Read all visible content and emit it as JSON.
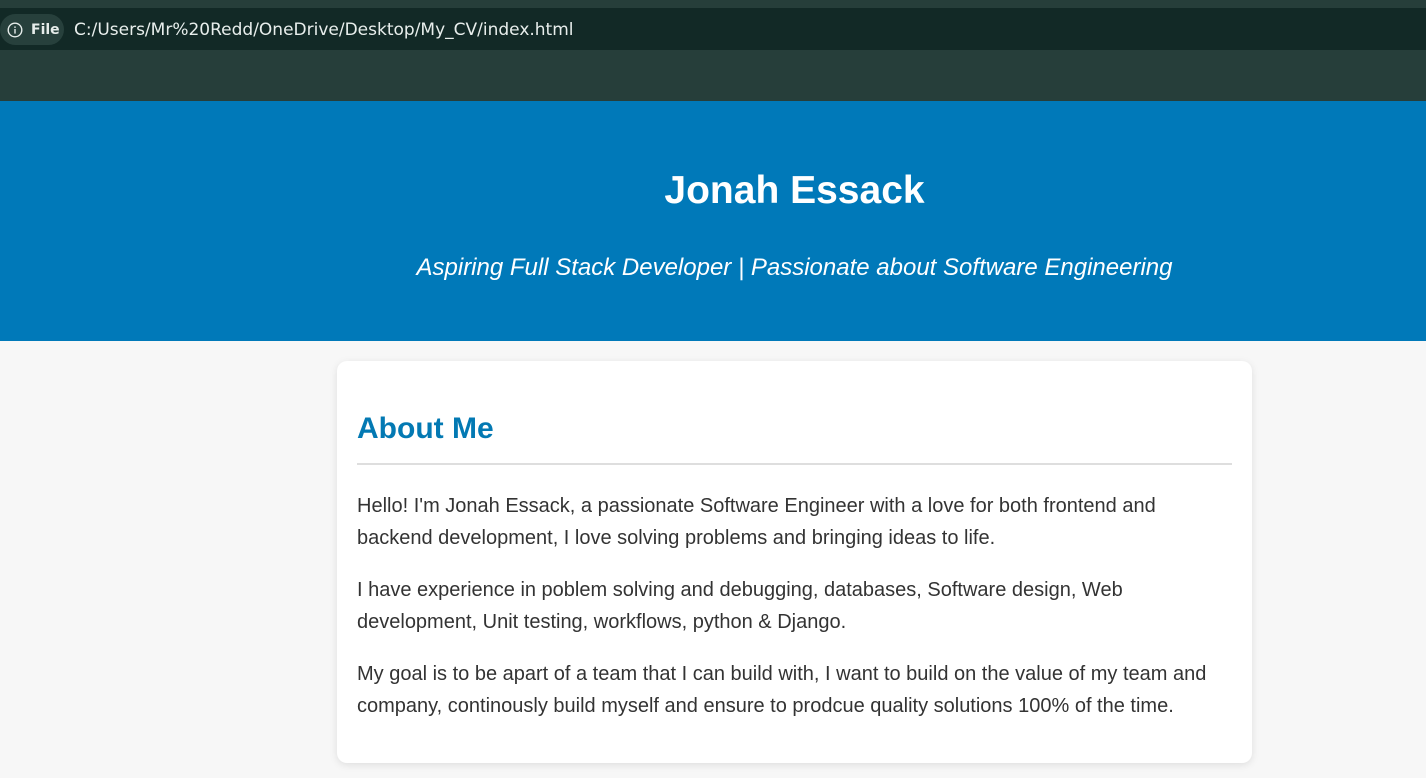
{
  "browser": {
    "file_label": "File",
    "url": "C:/Users/Mr%20Redd/OneDrive/Desktop/My_CV/index.html",
    "info_icon": "info-circle-icon"
  },
  "hero": {
    "name": "Jonah Essack",
    "tagline": "Aspiring Full Stack Developer | Passionate about Software Engineering"
  },
  "about": {
    "title": "About Me",
    "paragraphs": [
      "Hello! I'm Jonah Essack, a passionate Software Engineer with a love for both frontend and backend development, I love solving problems and bringing ideas to life.",
      "I have experience in poblem solving and debugging, databases, Software design, Web development, Unit testing, workflows, python & Django.",
      "My goal is to be apart of a team that I can build with, I want to build on the value of my team and company, continously build myself and ensure to prodcue quality solutions 100% of the time."
    ]
  },
  "colors": {
    "browser_chrome": "#263e3a",
    "address_bar": "#122926",
    "hero_background": "#0079b9",
    "accent_title": "#0379b3",
    "page_background": "#f7f7f7"
  }
}
